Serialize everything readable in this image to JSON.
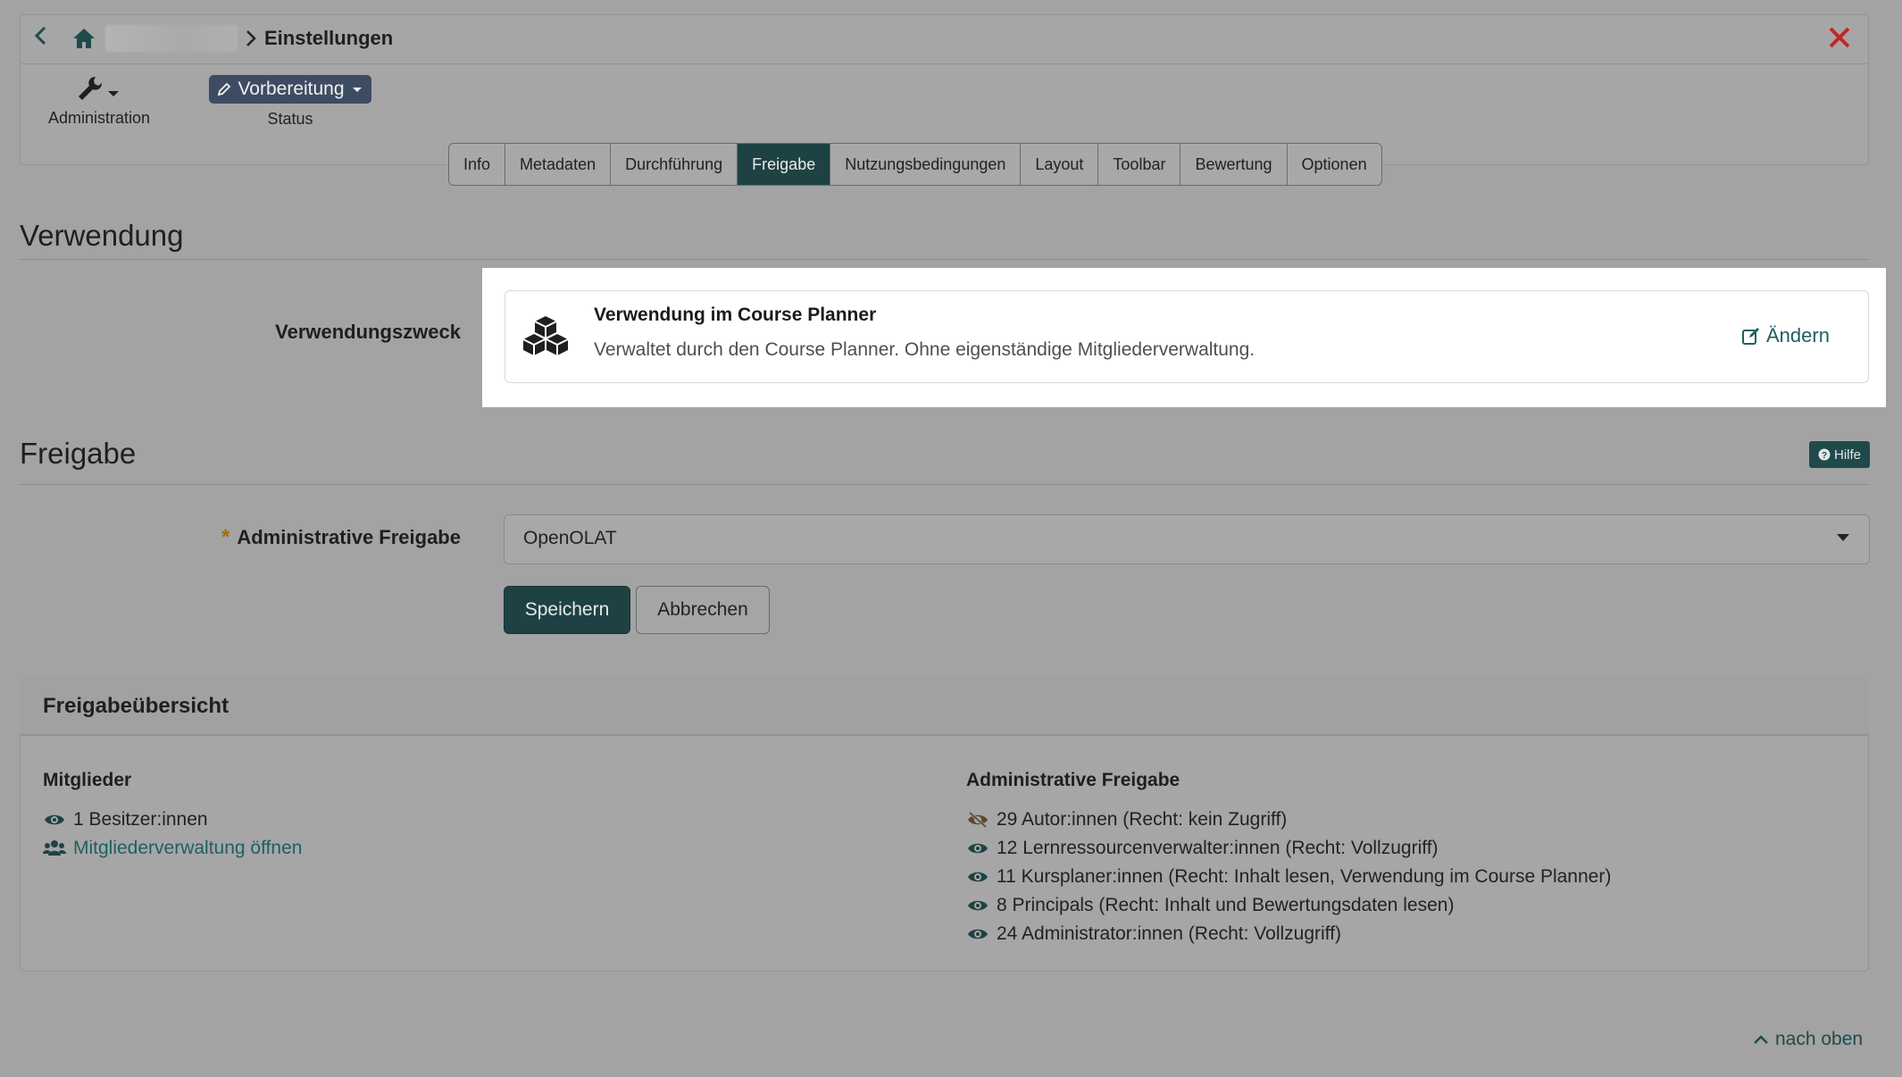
{
  "breadcrumb": {
    "current": "Einstellungen"
  },
  "toolbar": {
    "admin_label": "Administration",
    "status_value": "Vorbereitung",
    "status_label": "Status"
  },
  "tabs": [
    {
      "label": "Info"
    },
    {
      "label": "Metadaten"
    },
    {
      "label": "Durchführung"
    },
    {
      "label": "Freigabe",
      "active": true
    },
    {
      "label": "Nutzungsbedingungen"
    },
    {
      "label": "Layout"
    },
    {
      "label": "Toolbar"
    },
    {
      "label": "Bewertung"
    },
    {
      "label": "Optionen"
    }
  ],
  "verwendung": {
    "title": "Verwendung",
    "purpose_label": "Verwendungszweck",
    "purpose_title": "Verwendung im Course Planner",
    "purpose_desc": "Verwaltet durch den Course Planner. Ohne eigenständige Mitgliederverwaltung.",
    "change_label": "Ändern"
  },
  "freigabe": {
    "title": "Freigabe",
    "help_label": "Hilfe",
    "admin_label": "Administrative Freigabe",
    "select_value": "OpenOLAT",
    "save_label": "Speichern",
    "cancel_label": "Abbrechen"
  },
  "overview": {
    "title": "Freigabeübersicht",
    "members_title": "Mitglieder",
    "members": [
      {
        "text": "1 Besitzer:innen",
        "icon": "eye-icon"
      },
      {
        "text": "Mitgliederverwaltung öffnen",
        "icon": "users-icon",
        "link": true
      }
    ],
    "admin_title": "Administrative Freigabe",
    "admin_items": [
      {
        "text": "29 Autor:innen (Recht: kein Zugriff)",
        "icon": "eye-slash-icon"
      },
      {
        "text": "12 Lernressourcenverwalter:innen (Recht: Vollzugriff)",
        "icon": "eye-icon"
      },
      {
        "text": "11 Kursplaner:innen (Recht: Inhalt lesen, Verwendung im Course Planner)",
        "icon": "eye-icon"
      },
      {
        "text": "8 Principals (Recht: Inhalt und Bewertungsdaten lesen)",
        "icon": "eye-icon"
      },
      {
        "text": "24 Administrator:innen (Recht: Vollzugriff)",
        "icon": "eye-icon"
      }
    ]
  },
  "footer": {
    "top_link": "nach oben"
  },
  "colors": {
    "accent": "#1e4243",
    "link": "#1f5f63",
    "status_button": "#3e4c63",
    "close": "#c0282a",
    "required": "#a36a10"
  }
}
